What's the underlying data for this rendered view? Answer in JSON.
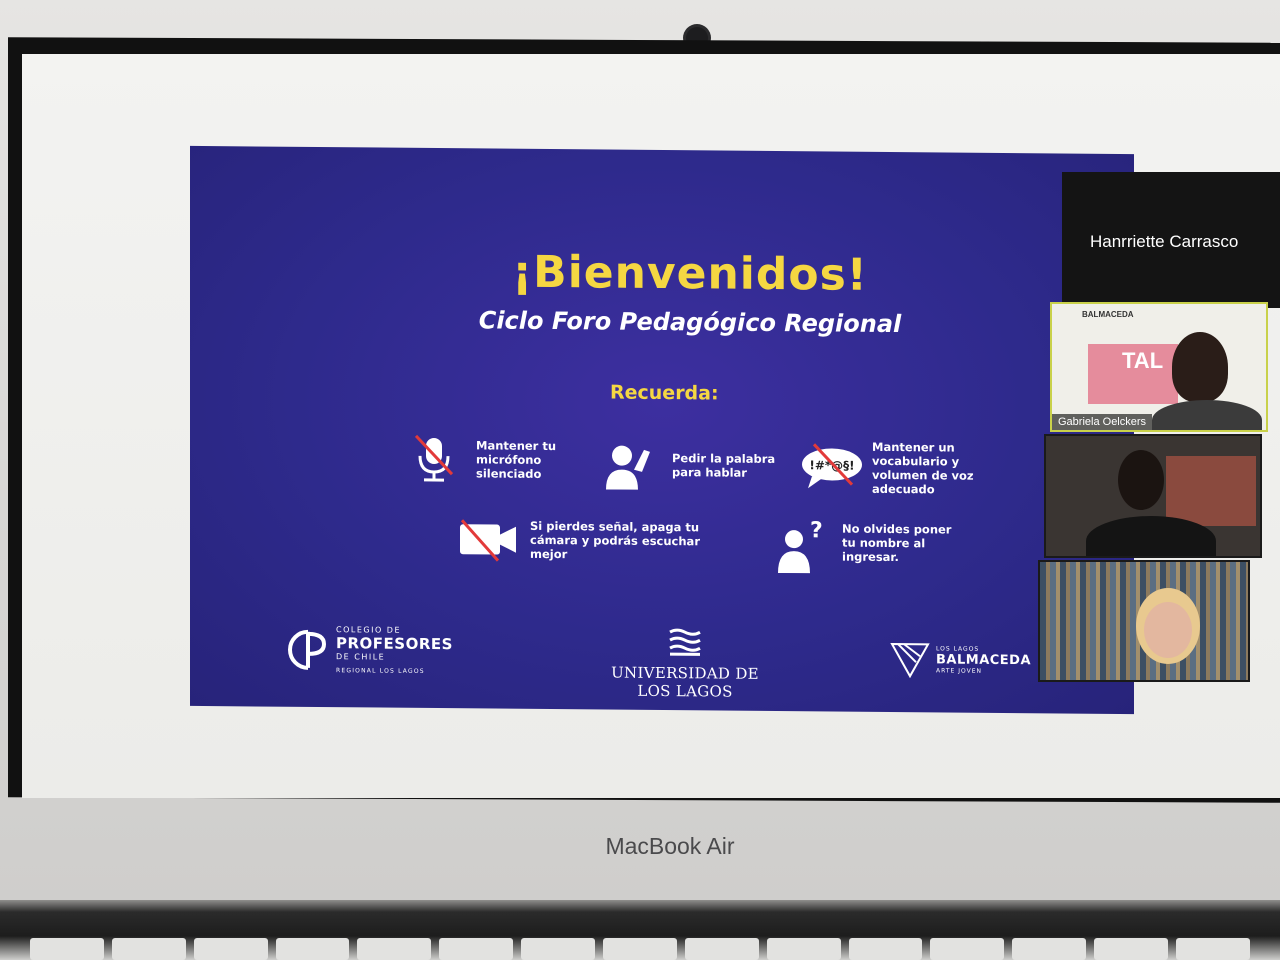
{
  "slide": {
    "title": "¡Bienvenidos!",
    "subtitle": "Ciclo Foro Pedagógico Regional",
    "recuerda": "Recuerda:",
    "rules": [
      {
        "icon": "muted-microphone-icon",
        "text": "Mantener tu\nmicrófono\nsilenciado"
      },
      {
        "icon": "raised-hand-icon",
        "text": "Pedir la palabra\npara hablar"
      },
      {
        "icon": "no-swearing-speech-bubble-icon",
        "icon_text": "!#*@§!",
        "text": "Mantener un\nvocabulario y\nvolumen de voz\nadecuado"
      },
      {
        "icon": "camera-off-icon",
        "text": "Si pierdes señal, apaga tu\ncámara y podrás escuchar\nmejor"
      },
      {
        "icon": "question-person-icon",
        "text": "No olvides poner\ntu nombre al\ningresar."
      }
    ],
    "logos": {
      "profesores": {
        "line1": "COLEGIO DE",
        "line2": "PROFESORES",
        "line3": "DE CHILE",
        "line4": "REGIONAL LOS LAGOS"
      },
      "ulagos": {
        "name": "UNIVERSIDAD DE LOS LAGOS"
      },
      "balmaceda": {
        "line1": "LOS LAGOS",
        "line2": "BALMACEDA",
        "line3": "ARTE JOVEN"
      }
    },
    "colors": {
      "background": "#2e2a8c",
      "accent": "#f5d742",
      "text": "#ffffff"
    }
  },
  "participants": {
    "active_speaker": "Hanrriette Carrasco",
    "tiles": [
      {
        "label": "Gabriela Oelckers",
        "backdrop_text": "BALMACEDA",
        "backdrop_big": "TAL"
      },
      {
        "label": ""
      },
      {
        "label": ""
      }
    ]
  },
  "device": {
    "brand": "MacBook Air"
  }
}
